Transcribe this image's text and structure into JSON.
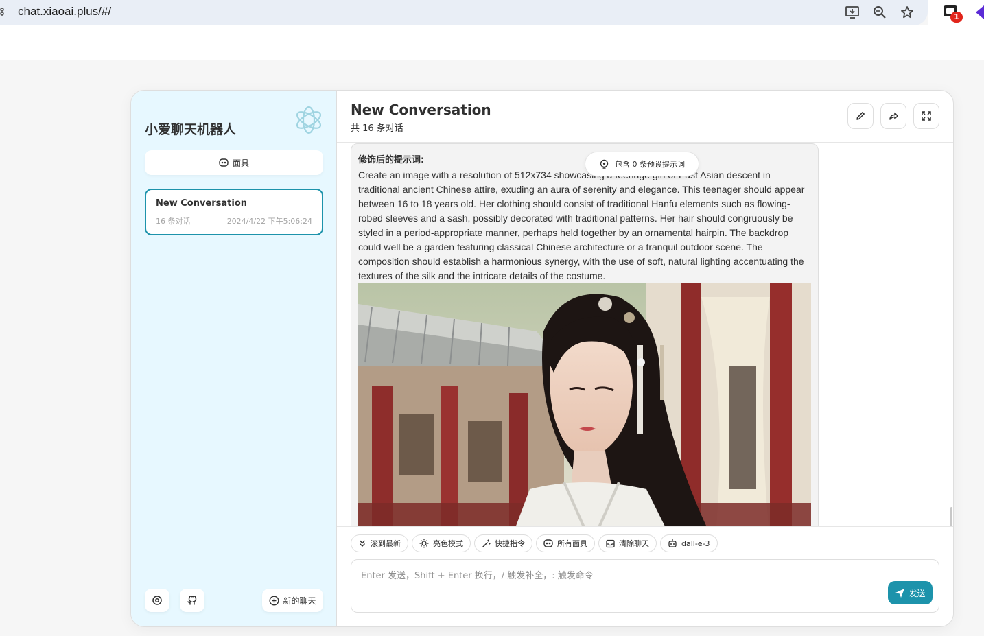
{
  "browser": {
    "url": "chat.xiaoai.plus/#/",
    "extension_badge": "1"
  },
  "sidebar": {
    "title": "小爱聊天机器人",
    "mask_button": "面具",
    "chats": [
      {
        "title": "New Conversation",
        "count": "16 条对话",
        "time": "2024/4/22 下午5:06:24"
      }
    ],
    "new_chat": "新的聊天"
  },
  "header": {
    "title": "New Conversation",
    "subtitle": "共 16 条对话"
  },
  "message": {
    "heading": "修饰后的提示词:",
    "text": "Create an image with a resolution of 512x734 showcasing a teenage girl of East Asian descent in traditional ancient Chinese attire, exuding an aura of serenity and elegance. This teenager should appear between 16 to 18 years old. Her clothing should consist of traditional Hanfu elements such as flowing-robed sleeves and a sash, possibly decorated with traditional patterns. Her hair should congruously be styled in a period-appropriate manner, perhaps held together by an ornamental hairpin. The backdrop could well be a garden featuring classical Chinese architecture or a tranquil outdoor scene. The composition should establish a harmonious synergy, with the use of soft, natural lighting accentuating the textures of the silk and the intricate details of the costume."
  },
  "prompt_pill": "包含 0 条预设提示词",
  "actions": [
    {
      "label": "滚到最新",
      "icon": "double-chevron-down-icon"
    },
    {
      "label": "亮色模式",
      "icon": "sun-icon"
    },
    {
      "label": "快捷指令",
      "icon": "magic-wand-icon"
    },
    {
      "label": "所有面具",
      "icon": "mask-icon"
    },
    {
      "label": "清除聊天",
      "icon": "broom-icon"
    },
    {
      "label": "dall-e-3",
      "icon": "robot-icon"
    }
  ],
  "input": {
    "placeholder": "Enter 发送，Shift + Enter 换行，/ 触发补全，: 触发命令",
    "send_label": "发送"
  },
  "colors": {
    "accent": "#1d93ab",
    "sidebar_bg": "#e7f8ff"
  }
}
